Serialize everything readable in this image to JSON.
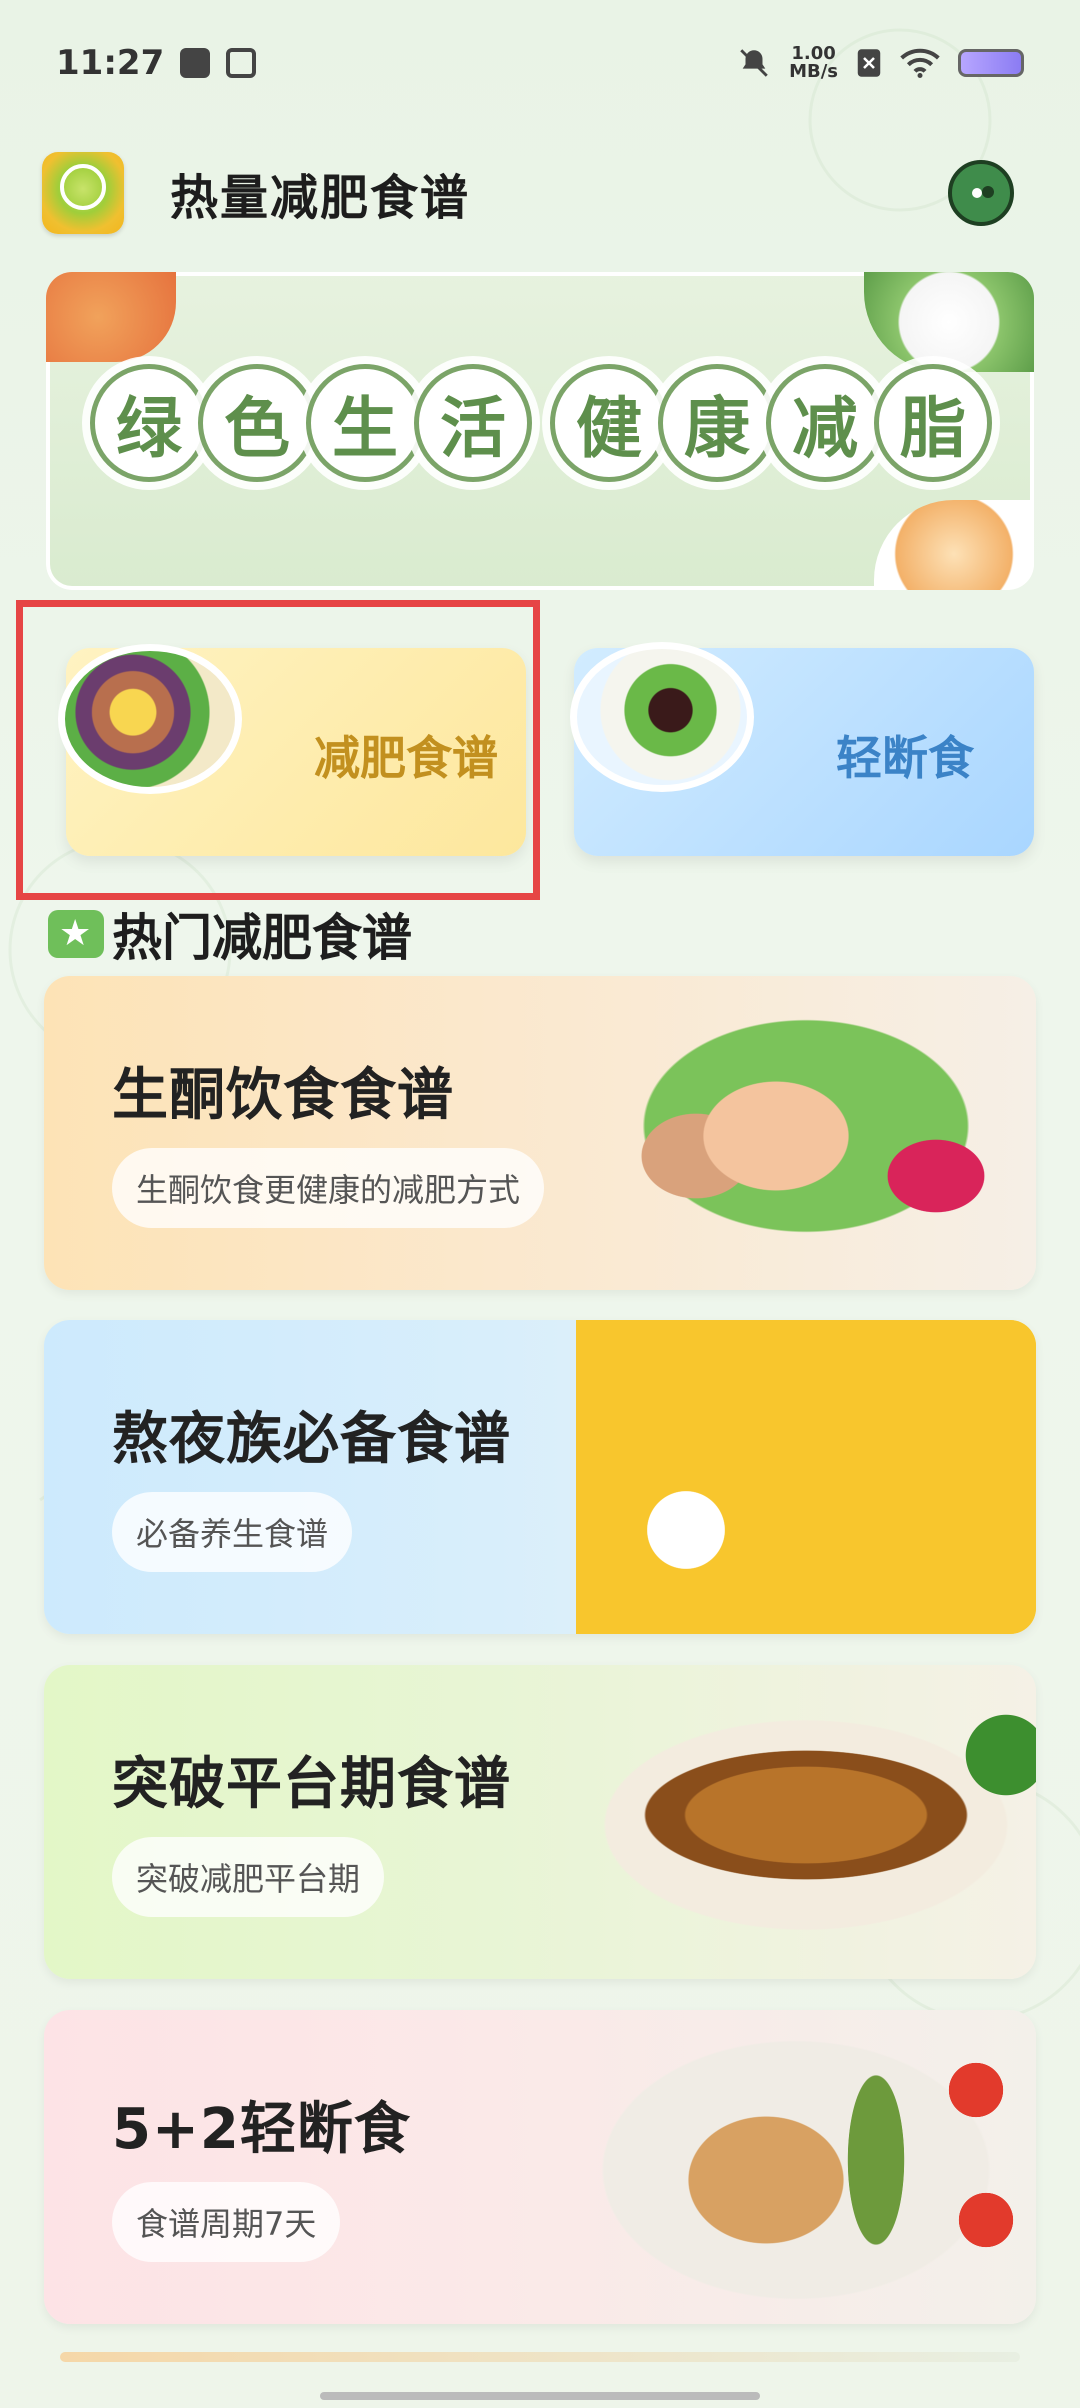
{
  "status_bar": {
    "time": "11:27",
    "net_speed_value": "1.00",
    "net_speed_unit": "MB/s"
  },
  "header": {
    "app_title": "热量减肥食谱",
    "logo_icon": "app-logo-icon",
    "profile_icon": "profile-icon"
  },
  "banner": {
    "slogan_left": [
      "绿",
      "色",
      "生",
      "活"
    ],
    "slogan_right": [
      "健",
      "康",
      "减",
      "脂"
    ]
  },
  "categories": [
    {
      "label": "减肥食谱",
      "color": "#c2901f"
    },
    {
      "label": "轻断食",
      "color": "#3b83c7"
    }
  ],
  "section": {
    "title": "热门减肥食谱",
    "icon": "star-icon"
  },
  "recipes": [
    {
      "title": "生酮饮食食谱",
      "subtitle": "生酮饮食更健康的减肥方式"
    },
    {
      "title": "熬夜族必备食谱",
      "subtitle": "必备养生食谱"
    },
    {
      "title": "突破平台期食谱",
      "subtitle": "突破减肥平台期"
    },
    {
      "title": "5+2轻断食",
      "subtitle": "食谱周期7天"
    }
  ],
  "colors": {
    "highlight": "#e64545",
    "accent_green": "#6fbf5a"
  }
}
